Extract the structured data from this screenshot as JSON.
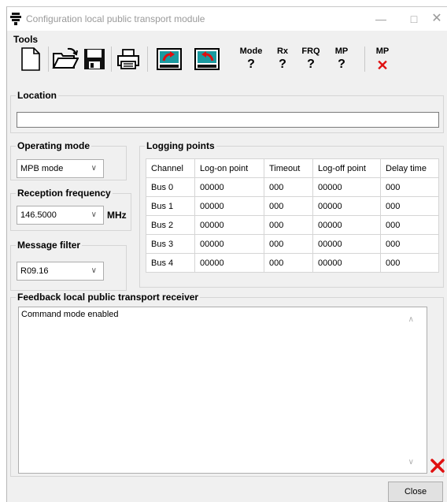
{
  "window": {
    "title": "Configuration local public transport module",
    "controls": {
      "minimize": "—",
      "maximize": "□",
      "close": "✕"
    }
  },
  "tools": {
    "title": "Tools",
    "buttons": [
      {
        "name": "new-document-icon"
      },
      {
        "name": "open-folder-icon"
      },
      {
        "name": "save-disk-icon"
      },
      {
        "name": "printer-icon"
      },
      {
        "name": "upload-to-device-icon"
      },
      {
        "name": "download-from-device-icon"
      }
    ],
    "status": [
      {
        "label": "Mode",
        "value": "?"
      },
      {
        "label": "Rx",
        "value": "?"
      },
      {
        "label": "FRQ",
        "value": "?"
      },
      {
        "label": "MP",
        "value": "?"
      }
    ],
    "mp_error": {
      "label": "MP",
      "value": "✕",
      "color": "#e01010"
    }
  },
  "location": {
    "title": "Location",
    "value": ""
  },
  "operating_mode": {
    "title": "Operating mode",
    "selected": "MPB mode"
  },
  "reception_frequency": {
    "title": "Reception frequency",
    "selected": "146.5000",
    "unit": "MHz"
  },
  "message_filter": {
    "title": "Message filter",
    "selected": "R09.16"
  },
  "logging_points": {
    "title": "Logging points",
    "columns": [
      "Channel",
      "Log-on point",
      "Timeout",
      "Log-off point",
      "Delay time"
    ],
    "rows": [
      [
        "Bus 0",
        "00000",
        "000",
        "00000",
        "000"
      ],
      [
        "Bus 1",
        "00000",
        "000",
        "00000",
        "000"
      ],
      [
        "Bus 2",
        "00000",
        "000",
        "00000",
        "000"
      ],
      [
        "Bus 3",
        "00000",
        "000",
        "00000",
        "000"
      ],
      [
        "Bus 4",
        "00000",
        "000",
        "00000",
        "000"
      ]
    ]
  },
  "feedback": {
    "title": "Feedback local public transport receiver",
    "text": "Command mode enabled",
    "scroll_up": "∧",
    "scroll_down": "∨"
  },
  "close_label": "Close",
  "colors": {
    "accent_red": "#e01010",
    "teal_icon": "#1a9aa0"
  }
}
